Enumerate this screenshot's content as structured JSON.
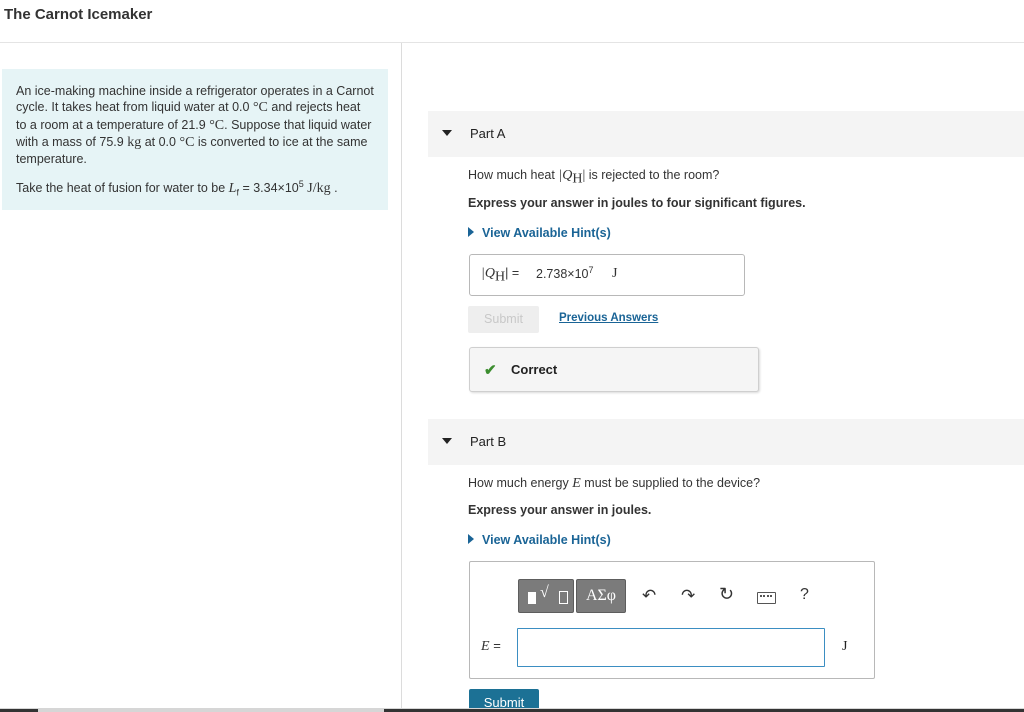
{
  "page": {
    "title": "The Carnot Icemaker"
  },
  "problem": {
    "intro_1": "An ice-making machine inside a refrigerator operates in a Carnot cycle. It takes heat from liquid water at",
    "t1_value": "0.0",
    "t_unit": "°C",
    "intro_2": "and rejects heat to a room at a temperature of",
    "t2_value": "21.9",
    "intro_3": ". Suppose that liquid water with a mass of",
    "mass_value": "75.9",
    "mass_unit": "kg",
    "intro_4": "at",
    "intro_5": "is converted to ice at the same temperature.",
    "fusion_prefix": "Take the heat of fusion for water to be",
    "fusion_symbol": "L",
    "fusion_sub": "f",
    "fusion_value": "= 3.34×10",
    "fusion_exp": "5",
    "fusion_unit": "J/kg",
    "fusion_end": "."
  },
  "part_a": {
    "label": "Part A",
    "question_pre": "How much heat",
    "question_symbol": "|Q",
    "question_sub": "H",
    "question_close": "|",
    "question_post": "is rejected to the room?",
    "instruction": "Express your answer in joules to four significant figures.",
    "hint_label": "View Available Hint(s)",
    "answer_lhs_symbol": "|Q",
    "answer_lhs_sub": "H",
    "answer_lhs_close": "| =",
    "answer_mantissa": "2.738×10",
    "answer_exp": "7",
    "answer_unit": "J",
    "submit_label": "Submit",
    "previous_answers_label": "Previous Answers",
    "feedback": "Correct"
  },
  "part_b": {
    "label": "Part B",
    "question_pre": "How much energy",
    "question_symbol": "E",
    "question_post": "must be supplied to the device?",
    "instruction": "Express your answer in joules.",
    "hint_label": "View Available Hint(s)",
    "toolbar": {
      "templates_icon": "templates-icon",
      "greek_label": "ΑΣφ",
      "undo_icon": "undo-icon",
      "redo_icon": "redo-icon",
      "reset_icon": "reset-icon",
      "keyboard_icon": "keyboard-icon",
      "help_label": "?"
    },
    "input_lhs": "E =",
    "input_value": "",
    "input_unit": "J",
    "submit_label": "Submit"
  },
  "colors": {
    "problem_bg": "#e6f4f6",
    "link": "#1a6496",
    "success": "#3c8d2f",
    "submit": "#1c7195",
    "toolbar_btn": "#7b7b7b"
  }
}
